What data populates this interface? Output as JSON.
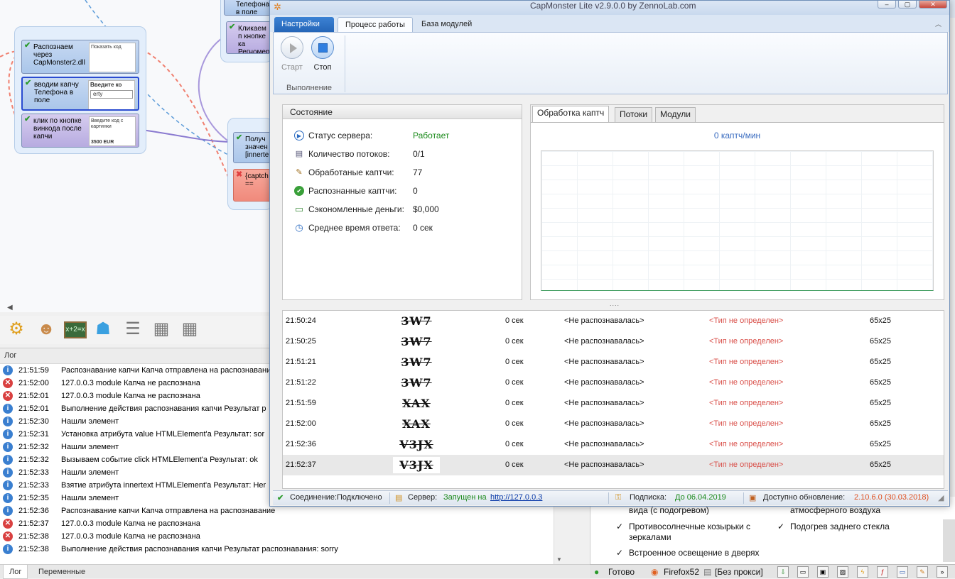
{
  "editor": {
    "blocks": [
      {
        "text": "Телефона в поле"
      },
      {
        "text": "Кликаем п кнопке ка Регномер"
      },
      {
        "text": "Распознаем через CapMonster2.dll",
        "thumb": "Показать код"
      },
      {
        "text": "вводим капчу Телефона в поле",
        "thumb_label": "Введите ко",
        "thumb_value": "erty"
      },
      {
        "text": "клик по кнопке винкода после капчи",
        "thumb": "Введите код с картинки",
        "thumb2": "3500 EUR"
      },
      {
        "text": "Получ значен [innerte"
      },
      {
        "text": "{captch =="
      }
    ]
  },
  "log": {
    "header": "Лог",
    "rows": [
      {
        "type": "info",
        "time": "21:51:59",
        "msg": "Распознавание капчи Капча отправлена на распознавание"
      },
      {
        "type": "err",
        "time": "21:52:00",
        "msg": " 127.0.0.3 module Капча не распознана"
      },
      {
        "type": "err",
        "time": "21:52:01",
        "msg": " 127.0.0.3 module Капча не распознана"
      },
      {
        "type": "info",
        "time": "21:52:01",
        "msg": "Выполнение действия распознавания капчи Результат р"
      },
      {
        "type": "info",
        "time": "21:52:30",
        "msg": "  Нашли элемент"
      },
      {
        "type": "info",
        "time": "21:52:31",
        "msg": "Установка атрибута value HTMLElement'a  Результат: sor"
      },
      {
        "type": "info",
        "time": "21:52:32",
        "msg": "  Нашли элемент"
      },
      {
        "type": "info",
        "time": "21:52:32",
        "msg": "Вызываем событие click HTMLElement'a  Результат: ok"
      },
      {
        "type": "info",
        "time": "21:52:33",
        "msg": "  Нашли элемент"
      },
      {
        "type": "info",
        "time": "21:52:33",
        "msg": "Взятие атрибута innertext HTMLElement'a  Результат: Her"
      },
      {
        "type": "info",
        "time": "21:52:35",
        "msg": "  Нашли элемент"
      },
      {
        "type": "info",
        "time": "21:52:36",
        "msg": "Распознавание капчи Капча отправлена на распознавание"
      },
      {
        "type": "err",
        "time": "21:52:37",
        "msg": " 127.0.0.3 module Капча не распознана"
      },
      {
        "type": "err",
        "time": "21:52:38",
        "msg": " 127.0.0.3 module Капча не распознана"
      },
      {
        "type": "info",
        "time": "21:52:38",
        "msg": "Выполнение действия распознавания капчи Результат распознавания: sorry"
      }
    ],
    "tabs": [
      "Лог",
      "Переменные"
    ]
  },
  "browser": {
    "features": [
      "вида (с подогревом)",
      "атмосферного воздуха",
      "Противосолнечные козырьки с зеркалами",
      "Подогрев заднего стекла",
      "Встроенное освещение в дверях"
    ],
    "status_ready": "Готово",
    "browser_name": "Firefox52",
    "proxy": "[Без прокси]"
  },
  "capmonster": {
    "title": "CapMonster Lite v2.9.0.0 by ZennoLab.com",
    "ribbon_tabs": [
      "Настройки",
      "Процесс работы",
      "База модулей"
    ],
    "start_label": "Старт",
    "stop_label": "Стоп",
    "group_label": "Выполнение",
    "state": {
      "header": "Состояние",
      "rows": [
        {
          "icon": "server-status-icon",
          "label": "Статус сервера:",
          "value": "Работает"
        },
        {
          "icon": "threads-icon",
          "label": "Количество потоков:",
          "value": "0/1"
        },
        {
          "icon": "processed-icon",
          "label": "Обработаные каптчи:",
          "value": "77"
        },
        {
          "icon": "recognized-icon",
          "label": "Распознанные каптчи:",
          "value": "0"
        },
        {
          "icon": "money-icon",
          "label": "Сэкономленные деньги:",
          "value": "$0,000"
        },
        {
          "icon": "clock-icon",
          "label": "Среднее время ответа:",
          "value": "0 сек"
        }
      ],
      "colors": {
        "working": "#1a8a1a"
      }
    },
    "chart_tabs": [
      "Обработка каптч",
      "Потоки",
      "Модули"
    ],
    "rate": "0 каптч/мин",
    "captcha_rows": [
      {
        "time": "21:50:24",
        "img": "3W7",
        "sec": "0 сек",
        "result": "<Не распознавалась>",
        "type": "<Тип не определен>",
        "size": "65x25"
      },
      {
        "time": "21:50:25",
        "img": "3W7",
        "sec": "0 сек",
        "result": "<Не распознавалась>",
        "type": "<Тип не определен>",
        "size": "65x25"
      },
      {
        "time": "21:51:21",
        "img": "3W7",
        "sec": "0 сек",
        "result": "<Не распознавалась>",
        "type": "<Тип не определен>",
        "size": "65x25"
      },
      {
        "time": "21:51:22",
        "img": "3W7",
        "sec": "0 сек",
        "result": "<Не распознавалась>",
        "type": "<Тип не определен>",
        "size": "65x25"
      },
      {
        "time": "21:51:59",
        "img": "XAX",
        "sec": "0 сек",
        "result": "<Не распознавалась>",
        "type": "<Тип не определен>",
        "size": "65x25"
      },
      {
        "time": "21:52:00",
        "img": "XAX",
        "sec": "0 сек",
        "result": "<Не распознавалась>",
        "type": "<Тип не определен>",
        "size": "65x25"
      },
      {
        "time": "21:52:36",
        "img": "V3JX",
        "sec": "0 сек",
        "result": "<Не распознавалась>",
        "type": "<Тип не определен>",
        "size": "65x25"
      },
      {
        "time": "21:52:37",
        "img": "V3JX",
        "sec": "0 сек",
        "result": "<Не распознавалась>",
        "type": "<Тип не определен>",
        "size": "65x25"
      }
    ],
    "status": {
      "conn_label": "Соединение:",
      "conn_value": "Подключено",
      "server_label": "Сервер:",
      "server_value": "Запущен на",
      "server_link": "http://127.0.0.3",
      "sub_label": "Подписка:",
      "sub_value": "До 06.04.2019",
      "update_label": "Доступно обновление:",
      "update_value": "2.10.6.0 (30.03.2018)"
    }
  }
}
